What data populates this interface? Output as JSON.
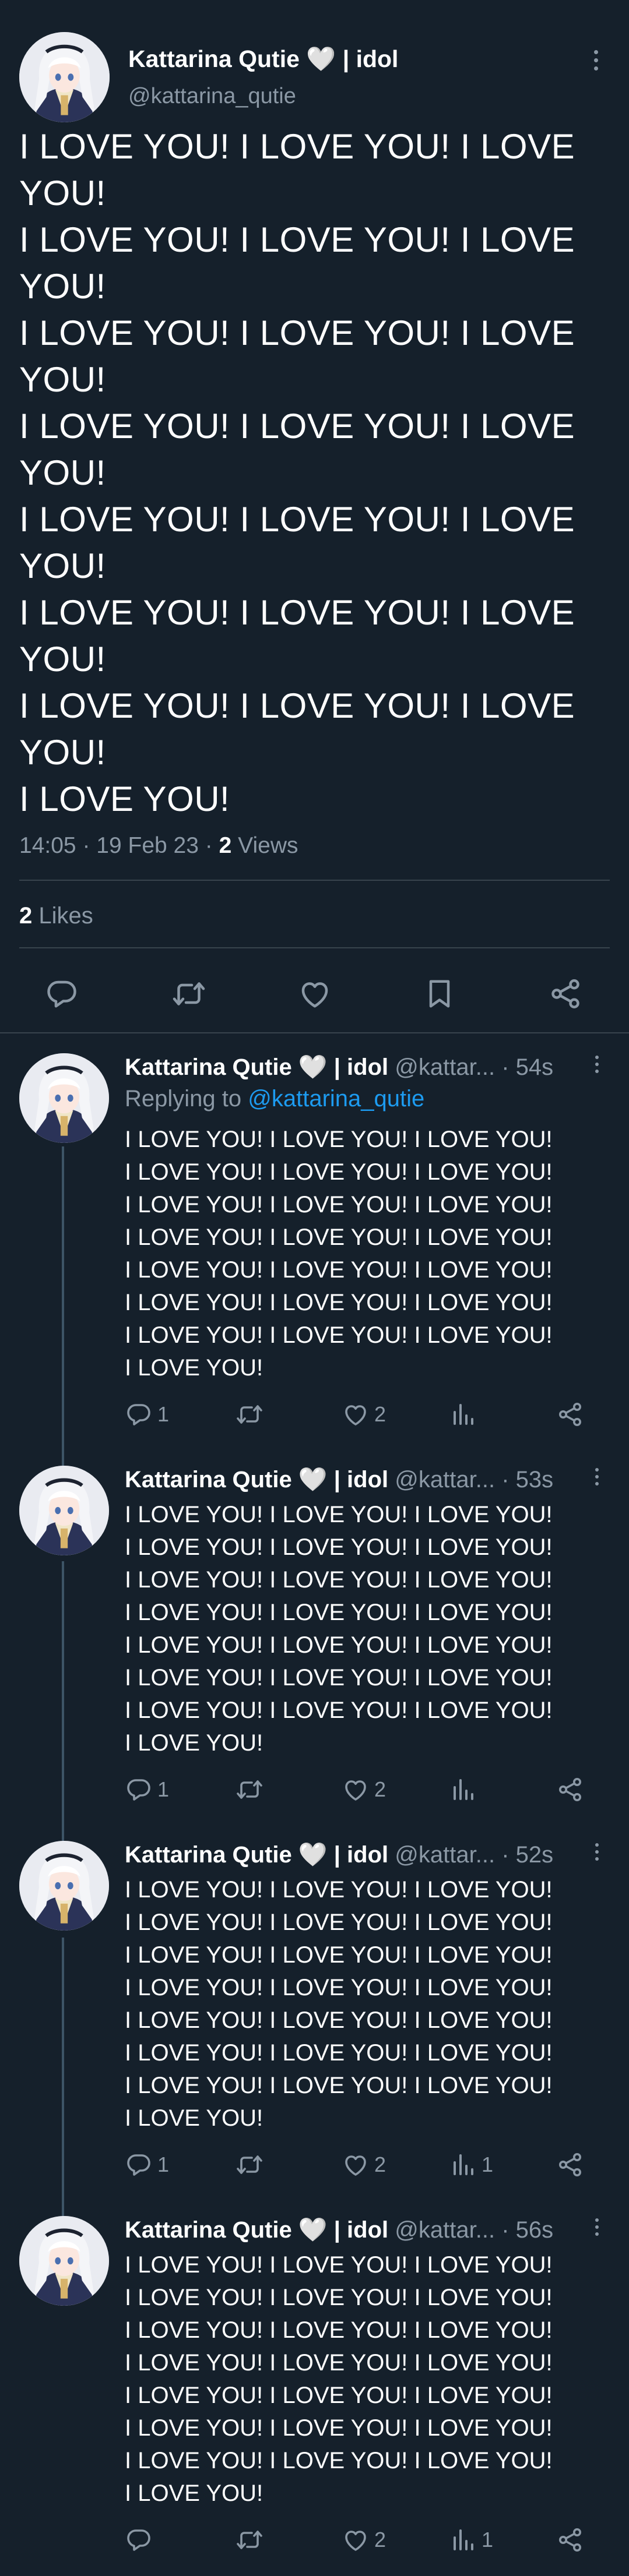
{
  "main_tweet": {
    "name": "Kattarina Qutie 🤍 | idol",
    "handle": "@kattarina_qutie",
    "text": "I LOVE YOU! I LOVE YOU! I LOVE\nYOU!\nI LOVE YOU! I LOVE YOU! I LOVE\nYOU!\nI LOVE YOU! I LOVE YOU! I LOVE\nYOU!\nI LOVE YOU! I LOVE YOU! I LOVE\nYOU!\nI LOVE YOU! I LOVE YOU! I LOVE\nYOU!\nI LOVE YOU! I LOVE YOU! I LOVE\nYOU!\nI LOVE YOU! I LOVE YOU! I LOVE\nYOU!\nI LOVE YOU!",
    "time": "14:05",
    "date": "19 Feb 23",
    "separator": "·",
    "views_count": "2",
    "views_label": "Views",
    "likes_count": "2",
    "likes_label": "Likes"
  },
  "icons": {
    "reply": "reply-icon",
    "retweet": "retweet-icon",
    "like": "heart-icon",
    "bookmark": "bookmark-icon",
    "share": "share-icon",
    "views": "views-icon",
    "more": "more-icon"
  },
  "colors": {
    "background": "#15202b",
    "secondary_text": "#8b98a5",
    "link": "#1d9bf0",
    "divider": "#38444d",
    "thread_line": "#3d5466"
  },
  "replies": [
    {
      "name": "Kattarina Qutie 🤍 | idol",
      "handle": "@kattar...",
      "time": "· 54s",
      "replying_prefix": "Replying to",
      "replying_to": "@kattarina_qutie",
      "text": "I LOVE YOU! I LOVE YOU! I LOVE YOU!\nI LOVE YOU! I LOVE YOU! I LOVE YOU!\nI LOVE YOU! I LOVE YOU! I LOVE YOU!\nI LOVE YOU! I LOVE YOU! I LOVE YOU!\nI LOVE YOU! I LOVE YOU! I LOVE YOU!\nI LOVE YOU! I LOVE YOU! I LOVE YOU!\nI LOVE YOU! I LOVE YOU! I LOVE YOU!\nI LOVE YOU!",
      "reply_count": "1",
      "retweet_count": "",
      "like_count": "2",
      "view_count": ""
    },
    {
      "name": "Kattarina Qutie 🤍 | idol",
      "handle": "@kattar...",
      "time": "· 53s",
      "text": "I LOVE YOU! I LOVE YOU! I LOVE YOU!\nI LOVE YOU! I LOVE YOU! I LOVE YOU!\nI LOVE YOU! I LOVE YOU! I LOVE YOU!\nI LOVE YOU! I LOVE YOU! I LOVE YOU!\nI LOVE YOU! I LOVE YOU! I LOVE YOU!\nI LOVE YOU! I LOVE YOU! I LOVE YOU!\nI LOVE YOU! I LOVE YOU! I LOVE YOU!\nI LOVE YOU!",
      "reply_count": "1",
      "retweet_count": "",
      "like_count": "2",
      "view_count": ""
    },
    {
      "name": "Kattarina Qutie 🤍 | idol",
      "handle": "@kattar...",
      "time": "· 52s",
      "text": "I LOVE YOU! I LOVE YOU! I LOVE YOU!\nI LOVE YOU! I LOVE YOU! I LOVE YOU!\nI LOVE YOU! I LOVE YOU! I LOVE YOU!\nI LOVE YOU! I LOVE YOU! I LOVE YOU!\nI LOVE YOU! I LOVE YOU! I LOVE YOU!\nI LOVE YOU! I LOVE YOU! I LOVE YOU!\nI LOVE YOU! I LOVE YOU! I LOVE YOU!\nI LOVE YOU!",
      "reply_count": "1",
      "retweet_count": "",
      "like_count": "2",
      "view_count": "1"
    },
    {
      "name": "Kattarina Qutie 🤍 | idol",
      "handle": "@kattar...",
      "time": "· 56s",
      "text": "I LOVE YOU! I LOVE YOU! I LOVE YOU!\nI LOVE YOU! I LOVE YOU! I LOVE YOU!\nI LOVE YOU! I LOVE YOU! I LOVE YOU!\nI LOVE YOU! I LOVE YOU! I LOVE YOU!\nI LOVE YOU! I LOVE YOU! I LOVE YOU!\nI LOVE YOU! I LOVE YOU! I LOVE YOU!\nI LOVE YOU! I LOVE YOU! I LOVE YOU!\nI LOVE YOU!",
      "reply_count": "",
      "retweet_count": "",
      "like_count": "2",
      "view_count": "1"
    }
  ]
}
